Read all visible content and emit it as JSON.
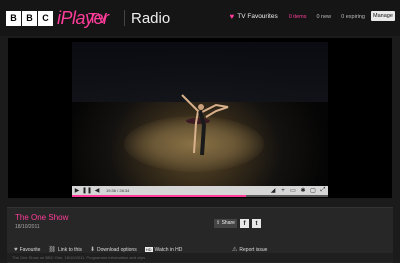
{
  "brand": {
    "logo_letters": "BBC",
    "product": "iPlayer",
    "accent": "#ff3c9a"
  },
  "nav": {
    "tv": "TV",
    "radio": "Radio"
  },
  "favourites": {
    "label": "TV Favourites",
    "items_count": "0 items",
    "new_count": "0 new",
    "expiring_count": "0 expiring",
    "manage": "Manage"
  },
  "player": {
    "time": "19:36 / 28:34",
    "progress": 0.68
  },
  "programme": {
    "title": "The One Show",
    "date": "18/10/2011"
  },
  "share": {
    "share_label": "Share",
    "facebook": "f",
    "twitter": "t"
  },
  "actions": {
    "favourite": "Favourite",
    "link": "Link to this",
    "download": "Download options",
    "hd_badge": "HD",
    "watch_hd": "Watch in HD",
    "report": "Report issue"
  },
  "footer": {
    "text": "The One Show on BBC One, 18/10/2011. Programme information and clips"
  }
}
